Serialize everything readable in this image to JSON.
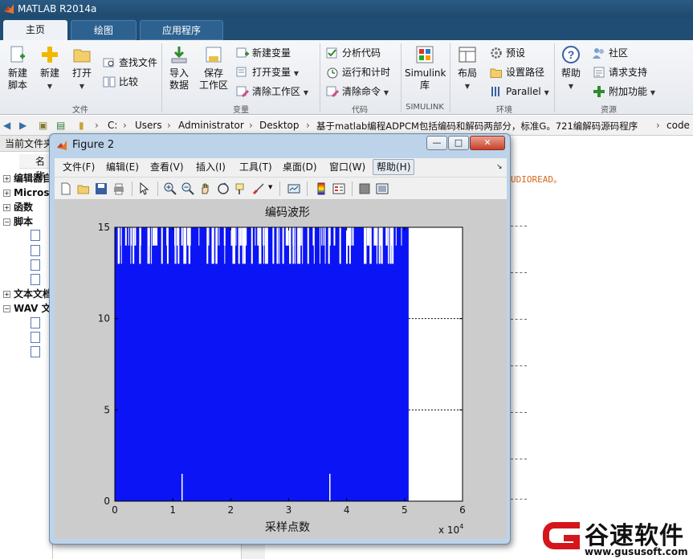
{
  "app": {
    "title": "MATLAB R2014a"
  },
  "tabs": [
    {
      "label": "主页"
    },
    {
      "label": "绘图"
    },
    {
      "label": "应用程序"
    }
  ],
  "ribbon": {
    "file": {
      "new_script": [
        "新建",
        "脚本"
      ],
      "new": "新建",
      "open": "打开",
      "find_files": "查找文件",
      "compare": "比较",
      "section": "文件"
    },
    "variable": {
      "import_data": [
        "导入",
        "数据"
      ],
      "save_workspace": [
        "保存",
        "工作区"
      ],
      "new_variable": "新建变量",
      "open_variable": "打开变量",
      "clear_workspace": "清除工作区",
      "section": "变量"
    },
    "code": {
      "analyze_code": "分析代码",
      "run_and_time": "运行和计时",
      "clear_commands": "清除命令",
      "section": "代码"
    },
    "simulink": {
      "label": [
        "Simulink",
        "库"
      ],
      "section": "SIMULINK"
    },
    "environment": {
      "layout": "布局",
      "preferences": "预设",
      "set_path": "设置路径",
      "parallel": "Parallel",
      "section": "环境"
    },
    "resources": {
      "help": "帮助",
      "community": "社区",
      "request_support": "请求支持",
      "add_ons": "附加功能",
      "section": "资源"
    }
  },
  "address": {
    "crumbs": [
      "C:",
      "Users",
      "Administrator",
      "Desktop",
      "基于matlab编程ADPCM包括编码和解码两部分，标准G。721编解码源码程序",
      "code"
    ]
  },
  "left_panel": {
    "title": "当前文件夹",
    "name_col": "名称",
    "tree": [
      {
        "sign": "+",
        "label": "编辑器自"
      },
      {
        "sign": "+",
        "label": "Micros"
      },
      {
        "sign": "+",
        "label": "函数"
      },
      {
        "sign": "−",
        "label": "脚本"
      },
      {
        "sign": "+",
        "label": "文本文档"
      },
      {
        "sign": "−",
        "label": "WAV 文"
      }
    ]
  },
  "command_window": {
    "visible_text": "UDIOREAD。"
  },
  "figure": {
    "window_title": "Figure 2",
    "menu": [
      "文件(F)",
      "编辑(E)",
      "查看(V)",
      "插入(I)",
      "工具(T)",
      "桌面(D)",
      "窗口(W)",
      "帮助(H)"
    ],
    "window_buttons": [
      "—",
      "□",
      "✕"
    ]
  },
  "chart_data": {
    "type": "bar",
    "title": "编码波形",
    "xlabel": "采样点数",
    "ylabel": "",
    "x_multiplier_label": "x 10",
    "x_multiplier_exp": "4",
    "xlim": [
      0,
      6
    ],
    "ylim": [
      0,
      15
    ],
    "xticks": [
      0,
      1,
      2,
      3,
      4,
      5,
      6
    ],
    "yticks": [
      0,
      5,
      10,
      15
    ],
    "data_extent_x": 5.07,
    "bar_color": "#0a14f5",
    "notes": "Dense blue stem/bar plot of ADPCM code values (0-15) across ~50700 samples; values mostly at 15 with frequent 13-14 dips; two isolated lows near x=1.15 and x=3.7."
  },
  "watermark": {
    "brand": "谷速软件",
    "url": "www.gususoft.com",
    "color": "#d4161c"
  }
}
